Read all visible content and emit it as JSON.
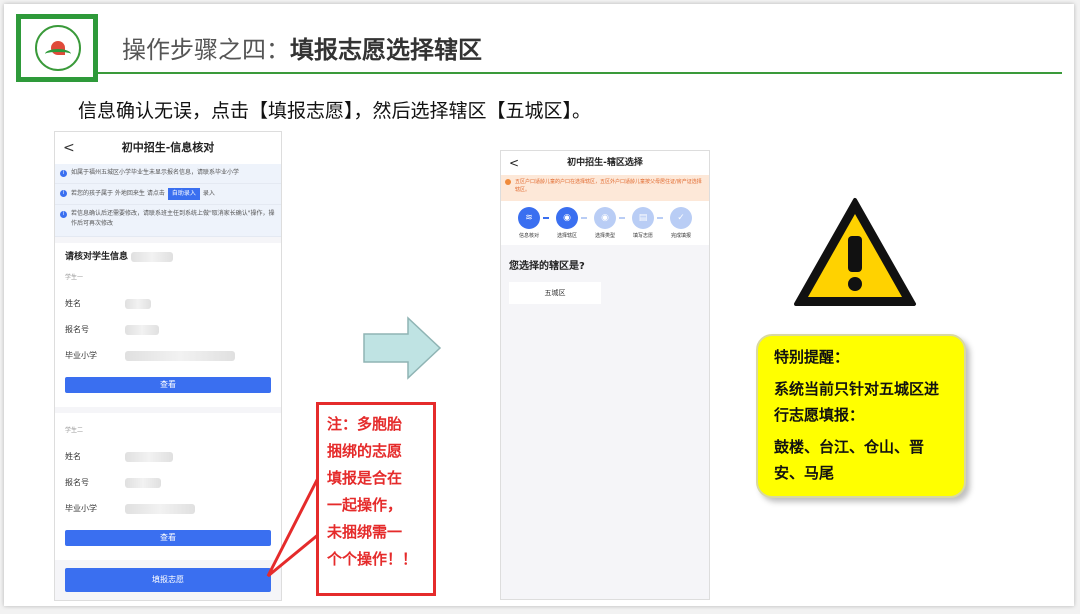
{
  "slide": {
    "title_prefix": "操作步骤之四：",
    "title_main": "填报志愿选择辖区",
    "instruction": "信息确认无误，点击【填报志愿】，然后选择辖区【五城区】。"
  },
  "phone1": {
    "back": "<",
    "header": "初中招生-信息核对",
    "notice1": "如属于福州五城区小学毕业生未显示报名信息，请联系毕业小学",
    "notice2_pre": "若您的孩子属于 外地回来生 请点击",
    "notice2_btn": "自助录入",
    "notice2_post": "录入",
    "notice3": "若信息确认后还需要修改，请联系班主任到系统上做\"取消家长确认\"操作，操作后可再次修改",
    "section_title": "请核对学生信息",
    "student1_label": "学生一",
    "student2_label": "学生二",
    "field_name": "姓名",
    "field_regno": "报名号",
    "field_school": "毕业小学",
    "view_button": "查看",
    "submit_button": "填报志愿"
  },
  "callout": {
    "lines": [
      "注：多胞胎",
      "捆绑的志愿",
      "填报是合在",
      "一起操作，",
      "未捆绑需一",
      "个个操作！！"
    ]
  },
  "phone2": {
    "back": "<",
    "header": "初中招生-辖区选择",
    "warning": "五区户口适龄儿童的户口在选择辖区，五区外户口适龄儿童按父母居住证/房产证选择辖区。",
    "steps": [
      "信息核对",
      "选择辖区",
      "选择类型",
      "填写志愿",
      "完成填报"
    ],
    "question": "您选择的辖区是?",
    "district": "五城区"
  },
  "reminder": {
    "title": "特别提醒：",
    "body": "系统当前只针对五城区进行志愿填报：",
    "districts": "鼓楼、台江、仓山、晋安、马尾"
  },
  "colors": {
    "brand_green": "#2e9a3a",
    "primary_blue": "#3a6ff0",
    "alert_red": "#e52b2b",
    "highlight_yellow": "#ffff00"
  }
}
